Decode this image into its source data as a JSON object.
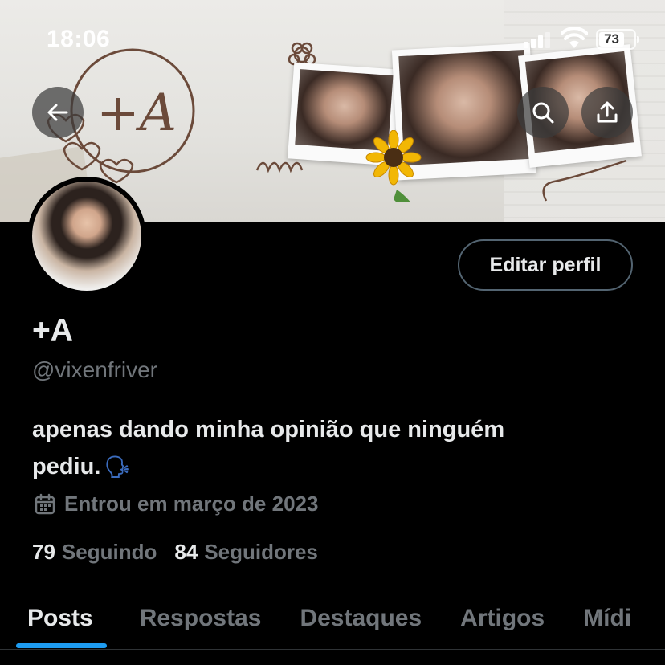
{
  "status_bar": {
    "time": "18:06",
    "battery": "73"
  },
  "banner": {
    "logo_text": "+A"
  },
  "actions": {
    "edit_profile": "Editar perfil"
  },
  "profile": {
    "name": "+A",
    "handle": "@vixenfriver",
    "bio_line1": "apenas dando minha opinião que ninguém",
    "bio_line2": "pediu.",
    "bio_emoji": "🗣",
    "joined": "Entrou em março de 2023",
    "following_count": "79",
    "following_label": "Seguindo",
    "followers_count": "84",
    "followers_label": "Seguidores"
  },
  "tabs": [
    {
      "label": "Posts"
    },
    {
      "label": "Respostas"
    },
    {
      "label": "Destaques"
    },
    {
      "label": "Artigos"
    },
    {
      "label": "Mídi"
    }
  ],
  "colors": {
    "accent": "#1d9bf0",
    "muted": "#71767b",
    "text": "#e7e9ea",
    "background": "#000000"
  },
  "icons": [
    "back-arrow-icon",
    "search-icon",
    "share-icon",
    "calendar-icon",
    "signal-icon",
    "wifi-icon",
    "battery-icon"
  ]
}
